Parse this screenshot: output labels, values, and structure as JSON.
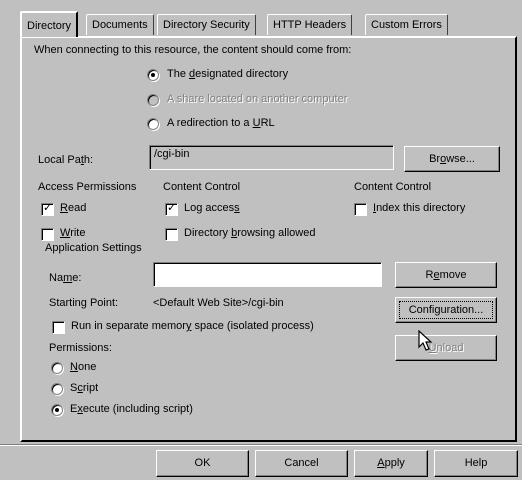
{
  "tabs": [
    {
      "label": "Directory",
      "active": true
    },
    {
      "label": "Documents",
      "active": false
    },
    {
      "label": "Directory Security",
      "active": false
    },
    {
      "label": "HTTP Headers",
      "active": false
    },
    {
      "label": "Custom Errors",
      "active": false
    }
  ],
  "intro_text": "When connecting to this resource, the content should come from:",
  "source_options": [
    {
      "label": "The designated directory",
      "selected": true,
      "enabled": true
    },
    {
      "label": "A share located on another computer",
      "selected": false,
      "enabled": false
    },
    {
      "label": "A redirection to a URL",
      "selected": false,
      "enabled": true
    }
  ],
  "local_path": {
    "label": "Local Path:",
    "value": "/cgi-bin",
    "browse_label": "Browse..."
  },
  "access_permissions": {
    "heading": "Access Permissions",
    "read": {
      "label": "Read",
      "checked": true
    },
    "write": {
      "label": "Write",
      "checked": false
    }
  },
  "content_control_1": {
    "heading": "Content Control",
    "log_access": {
      "label": "Log access",
      "checked": true
    },
    "dir_browsing": {
      "label": "Directory browsing allowed",
      "checked": false
    }
  },
  "content_control_2": {
    "heading": "Content Control",
    "index": {
      "label": "Index this directory",
      "checked": false
    }
  },
  "app_settings": {
    "legend": "Application Settings",
    "name_label": "Name:",
    "name_value": "",
    "remove_label": "Remove",
    "starting_point_label": "Starting Point:",
    "starting_point_value": "<Default Web Site>/cgi-bin",
    "configuration_label": "Configuration...",
    "unload_label": "Unload",
    "run_separate": {
      "label": "Run in separate memory space (isolated process)",
      "checked": false
    },
    "permissions_label": "Permissions:",
    "permissions": [
      {
        "label": "None",
        "selected": false
      },
      {
        "label": "Script",
        "selected": false
      },
      {
        "label": "Execute (including script)",
        "selected": true
      }
    ]
  },
  "dialog_buttons": {
    "ok": "OK",
    "cancel": "Cancel",
    "apply": "Apply",
    "help": "Help"
  },
  "check_glyph": "✓"
}
